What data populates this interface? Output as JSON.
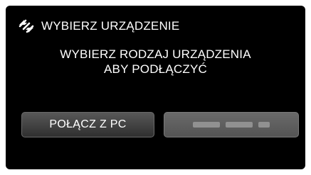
{
  "header": {
    "icon": "usb-connect-icon",
    "title": "WYBIERZ URZĄDZENIE"
  },
  "instruction": {
    "line1": "WYBIERZ RODZAJ URZĄDZENIA",
    "line2": "ABY PODŁĄCZYĆ"
  },
  "buttons": {
    "connect_pc": "POŁĄCZ Z PC",
    "second_option_state": "disabled"
  },
  "colors": {
    "screen_background": "#000000",
    "text": "#ffffff",
    "button_active": "#3f3f3f",
    "button_disabled": "#5f5f5f"
  }
}
